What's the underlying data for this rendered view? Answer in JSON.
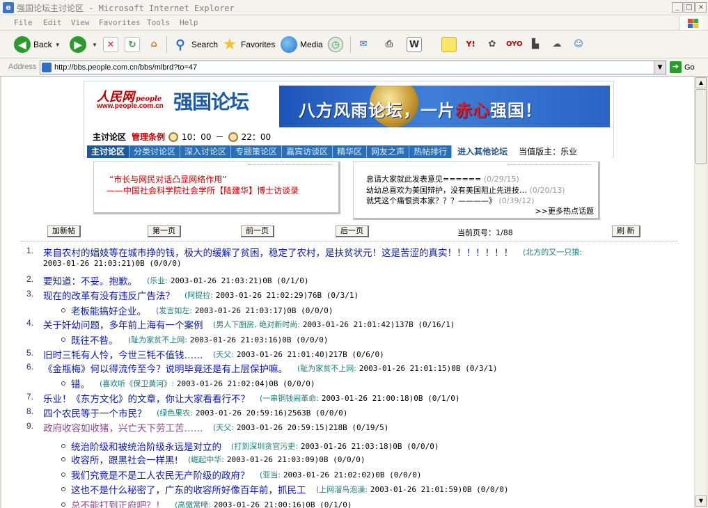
{
  "window": {
    "title": "强国论坛主讨论区 - Microsoft Internet Explorer"
  },
  "menu": [
    "File",
    "Edit",
    "View",
    "Favorites",
    "Tools",
    "Help"
  ],
  "toolbar": {
    "back": "Back",
    "search": "Search",
    "favorites": "Favorites",
    "media": "Media"
  },
  "address": {
    "label": "Address",
    "url": "http://bbs.people.com.cn/bbs/mlbrd?to=47",
    "go": "Go"
  },
  "header": {
    "logo_text": "人民网",
    "logo_en": "people",
    "logo_url": "www.people.com.cn",
    "forum": "强国论坛",
    "banner_a": "八方风雨论坛，一片",
    "banner_b": "赤心",
    "banner_c": "强国！",
    "section": "主讨论区",
    "rules": "管理条例",
    "time_start": "10：00",
    "time_sep": "－",
    "time_end": "22：00",
    "nav": [
      "主讨论区",
      "分类讨论区",
      "深入讨论区",
      "专题策论区",
      "嘉宾访谈区",
      "精华区",
      "网友之声",
      "热帖排行"
    ],
    "other": "进入其他论坛",
    "moderator": "当值版主：乐业"
  },
  "feature": {
    "line1": "“市长与网民对话凸显网络作用”",
    "line2": "——中国社会科学院社会学所【陆建华】博士访谈录"
  },
  "hot": {
    "items": [
      {
        "t": "息请大家就此发表意见======",
        "d": "(0/29/15)"
      },
      {
        "t": "幼幼总喜欢为美国辩护，没有美国阻止先进技…",
        "d": "(0/20/13)"
      },
      {
        "t": "就凭这个痛恨资本家？？？————》",
        "d": "(0/39/12)"
      }
    ],
    "more": ">>更多热点话题"
  },
  "pager": {
    "new_post": "加新帖",
    "first": "第一页",
    "prev": "前一页",
    "next": "后一页",
    "page_label": "当前页号：1/88",
    "refresh": "刷 新"
  },
  "posts": [
    {
      "num": "1.",
      "title": "来自农村的娼妓等在城市挣的钱，极大的缓解了贫困，稳定了农村，是扶贫状元！这是苦涩的真实！！！！！！！",
      "author": "(北方的又一只狼:",
      "meta": "2003-01-26 21:03:21)0B (0/0/0)"
    },
    {
      "num": "2.",
      "title": "要知道：不妥。抱歉。",
      "author": "(乐业:",
      "meta": "2003-01-26 21:03:21)0B (0/1/0)"
    },
    {
      "num": "3.",
      "title": "现在的改革有没有违反广告法？",
      "author": "(阿提拉:",
      "meta": "2003-01-26 21:02:29)76B (0/3/1)"
    },
    {
      "sub": "老板能搞好企业。",
      "author": "(发言如左:",
      "meta": "2003-01-26 21:03:17)0B (0/0/0)"
    },
    {
      "num": "4.",
      "title": "关于奸幼问题，多年前上海有一个案例",
      "author": "(男人下厨房, 绝对新时尚:",
      "meta": "2003-01-26 21:01:42)137B (0/16/1)"
    },
    {
      "sub": "既往不咎。",
      "author": "(耻为家贫不上网:",
      "meta": "2003-01-26 21:03:16)0B (0/0/0)"
    },
    {
      "num": "5.",
      "title": "旧时三牦有人怜，今世三牦不值钱……",
      "author": "(天父:",
      "meta": "2003-01-26 21:01:40)217B (0/6/0)"
    },
    {
      "num": "6.",
      "title": "《金瓶梅》何以得流传至今？说明毕竟还是有上层保护嘛。",
      "author": "(耻为家贫不上网:",
      "meta": "2003-01-26 21:01:15)0B (0/3/1)"
    },
    {
      "sub": "错。",
      "author": "(喜欢听《保卫黄河》:",
      "meta": "2003-01-26 21:02:04)0B (0/0/0)"
    },
    {
      "num": "7.",
      "title": "乐业！《东方文化》的文章，你让大家看看行不？",
      "author": "(一串铜钱闹革命:",
      "meta": "2003-01-26 21:00:18)0B (0/1/0)"
    },
    {
      "num": "8.",
      "title": "四个农民等于一个市民？",
      "author": "(绿色果农:",
      "meta": "2003-01-26 20:59:16)2563B (0/0/0)"
    },
    {
      "num": "9.",
      "title": "政府收容如收猪，兴亡天下劳工苦……",
      "author": "(天父:",
      "meta": "2003-01-26 20:59:15)218B (0/19/5)",
      "visited": true
    },
    {
      "sub": "统治阶级和被统治阶级永远是对立的",
      "author": "(打到深圳贪官污吏:",
      "meta": "2003-01-26 21:03:18)0B (0/0/0)"
    },
    {
      "sub": "收容所，跟黑社会一样黑!",
      "author": "(崛起中华:",
      "meta": "2003-01-26 21:03:09)0B (0/0/0)"
    },
    {
      "sub": "我们究竟是不是工人农民无产阶级的政府？",
      "author": "(亚当:",
      "meta": "2003-01-26 21:02:02)0B (0/0/0)"
    },
    {
      "sub": "这也不是什么秘密了，广东的收容所好像百年前，抓民工",
      "author": "(上网溜鸟泡澡:",
      "meta": "2003-01-26 21:01:59)0B (0/0/0)"
    },
    {
      "sub": "总不能打到正府吧？！",
      "author": "(高傲常啼:",
      "meta": "2003-01-26 21:00:16)0B (0/1/0)",
      "visited": true
    }
  ]
}
